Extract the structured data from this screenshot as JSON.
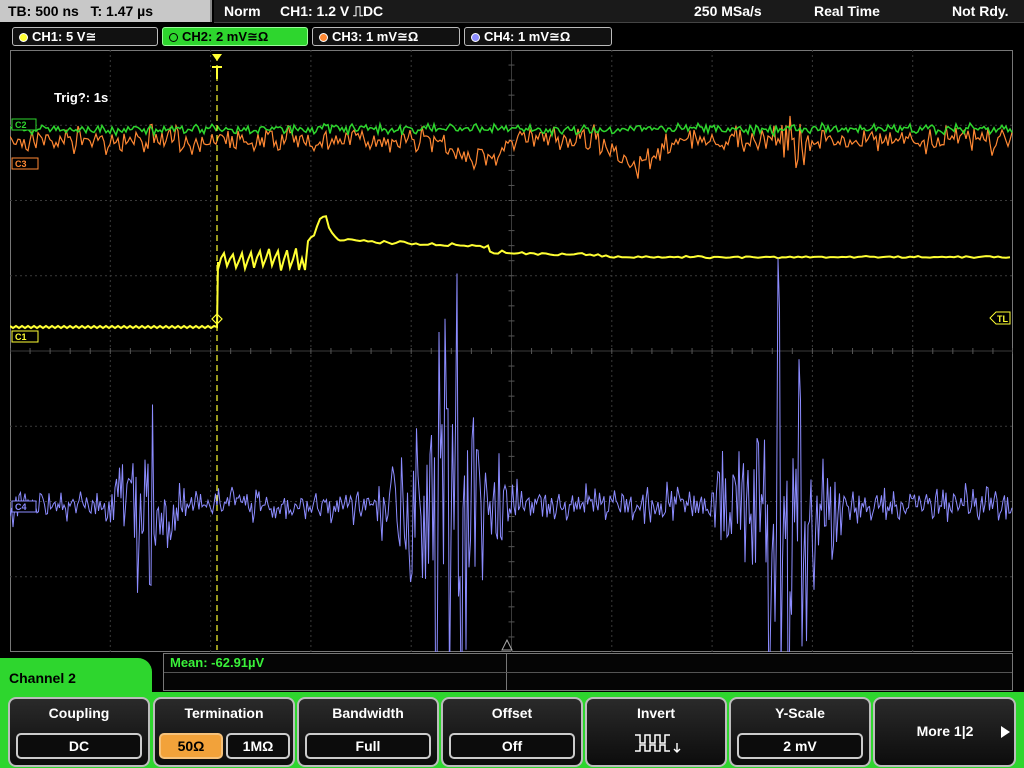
{
  "status": {
    "timebase": "TB: 500 ns",
    "trigger_time": "T: 1.47 µs",
    "trigger_mode": "Norm",
    "trigger_source": "CH1: 1.2 V ⎍DC",
    "sample_rate": "250 MSa/s",
    "acq_mode": "Real Time",
    "ready": "Not Rdy."
  },
  "channels": [
    {
      "label": "CH1: 5 V≅",
      "color": "#ffff33"
    },
    {
      "label": "CH2: 2 mV≅Ω",
      "color": "#2ed62e"
    },
    {
      "label": "CH3: 1 mV≅Ω",
      "color": "#ff8833"
    },
    {
      "label": "CH4: 1 mV≅Ω",
      "color": "#8c8cff"
    }
  ],
  "screen": {
    "trigger_status": "Trig?: 1s",
    "marker_c2": "C2",
    "marker_c3": "C3",
    "marker_c1": "C1",
    "marker_c4": "C4",
    "marker_tl": "TL"
  },
  "measurement": {
    "mean": "Mean: -62.91µV"
  },
  "menu": {
    "channel_title": "Channel 2",
    "coupling_title": "Coupling",
    "coupling_value": "DC",
    "termination_title": "Termination",
    "termination_50": "50Ω",
    "termination_1m": "1MΩ",
    "bandwidth_title": "Bandwidth",
    "bandwidth_value": "Full",
    "offset_title": "Offset",
    "offset_value": "Off",
    "invert_title": "Invert",
    "yscale_title": "Y-Scale",
    "yscale_value": "2 mV",
    "more_label": "More 1|2"
  },
  "icons": {
    "invert": "inverted-square-wave-icon",
    "more": "right-arrow-icon",
    "trigger": "trigger-marker-icon"
  },
  "colors": {
    "accent": "#2ed62e",
    "ch1": "#ffff33",
    "ch2": "#2ed62e",
    "ch3": "#ff8833",
    "ch4": "#8c8cff",
    "selected_option": "#f2a23a"
  }
}
